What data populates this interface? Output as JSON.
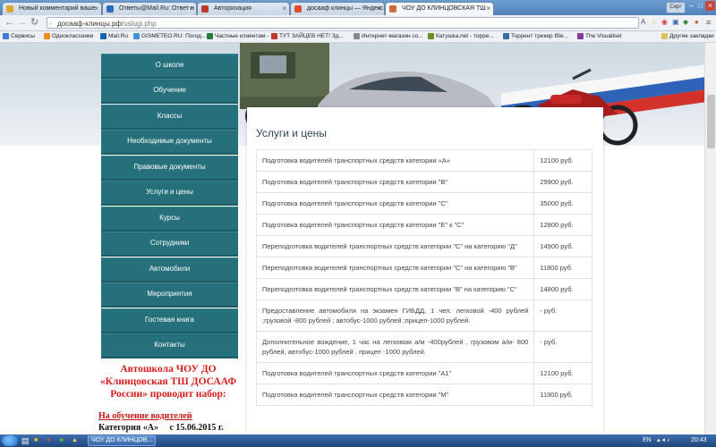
{
  "browser": {
    "tabs": [
      {
        "label": "Новый комментарий ваше",
        "favicon_color": "#e1a42b"
      },
      {
        "label": "Ответы@Mail.Ru: Ответ н",
        "favicon_color": "#2d6cc0"
      },
      {
        "label": "Авторизация",
        "favicon_color": "#c0392b"
      },
      {
        "label": "досааф клинцы — Яндекс",
        "favicon_color": "#e04b2b"
      },
      {
        "label": "ЧОУ ДО КЛИНЦОВСКАЯ ТШ",
        "favicon_color": "#d06a3a"
      }
    ],
    "user_badge": "Серг",
    "url_host": "досааф-клинцы.рф",
    "url_path": "/uslugi.php",
    "bookmarks": [
      {
        "label": "Сервисы",
        "color": "#3b7dd8"
      },
      {
        "label": "Одноклассники",
        "color": "#f08b1d"
      },
      {
        "label": "Mail.Ru",
        "color": "#1a5fb4"
      },
      {
        "label": "GISMETEO.RU: Погод...",
        "color": "#4a90d9"
      },
      {
        "label": "Частные клиентам -",
        "color": "#2a7a3b"
      },
      {
        "label": "ТУТ ЗАЙЦЕВ НЕТ! Зд...",
        "color": "#c0392b"
      },
      {
        "label": "Интернет-магазин со...",
        "color": "#888888"
      },
      {
        "label": "Катушка.net - торре...",
        "color": "#6b8e23"
      },
      {
        "label": "Торрент трекер tfile...",
        "color": "#3a6aa8"
      },
      {
        "label": "The Visualiser",
        "color": "#7d3c98"
      }
    ],
    "other_bookmarks": "Другие закладки"
  },
  "sidebar": {
    "items": [
      "О школе",
      "Обучение",
      "Классы",
      "Необходимые документы",
      "Правовые документы",
      "Услуги и цены",
      "Курсы",
      "Сотрудники",
      "Автомобили",
      "Мероприятия",
      "Гостевая книга",
      "Контакты"
    ]
  },
  "content": {
    "title": "Услуги и цены",
    "services": [
      {
        "name": "Подготовка водителей транспортных средств категории «А»",
        "price": "12100 руб."
      },
      {
        "name": "Подготовка водителей транспортных средств категории \"B\"",
        "price": "29900 руб."
      },
      {
        "name": "Подготовка водителей транспортных средств категории \"С\"",
        "price": "35000 руб."
      },
      {
        "name": "Подготовка водителей транспортных средств категории \"Е\" к \"С\"",
        "price": "12800 руб."
      },
      {
        "name": "Переподготовка водителей транспортных средств категории \"С\" на категорию \"Д\"",
        "price": "14900 руб."
      },
      {
        "name": "Переподготовка водителей транспортных средств категории \"С\" на категорию \"В\"",
        "price": "11800 руб."
      },
      {
        "name": "Переподготовка водителей транспортных средств категории \"В\" на категорию \"С\"",
        "price": "14800 руб."
      },
      {
        "name": "Предоставление автомобиля на экзамен ГИБДД, 1 чел. легковой -400 рублей ;грузовой -800 рублей ; автобус-1000 рублей ;прицеп-1000 рублей.",
        "price": "- руб."
      },
      {
        "name": "Дополнительное вождение, 1 час на легковом а/м -400рублей , грузовом а/м- 800 рублей, автобус-1000 рублей , прицеп -1000 рублей.",
        "price": "- руб."
      },
      {
        "name": "Подготовка водителей транспортных средств категории \"А1\"",
        "price": "12100 руб."
      },
      {
        "name": "Подготовка водителей транспортных средств категории \"М\"",
        "price": "11900 руб."
      }
    ]
  },
  "promo": {
    "headline": "Автошкола ЧОУ ДО «Клинцовская ТШ ДОСААФ России» проводит набор:",
    "sub": "На обучение водителей",
    "category_line": "Категория «А»     с 15.06.2015 г."
  },
  "taskbar": {
    "task_label": "ЧОУ ДО КЛИНЦОВ...",
    "lang": "EN",
    "time": "20:43"
  }
}
